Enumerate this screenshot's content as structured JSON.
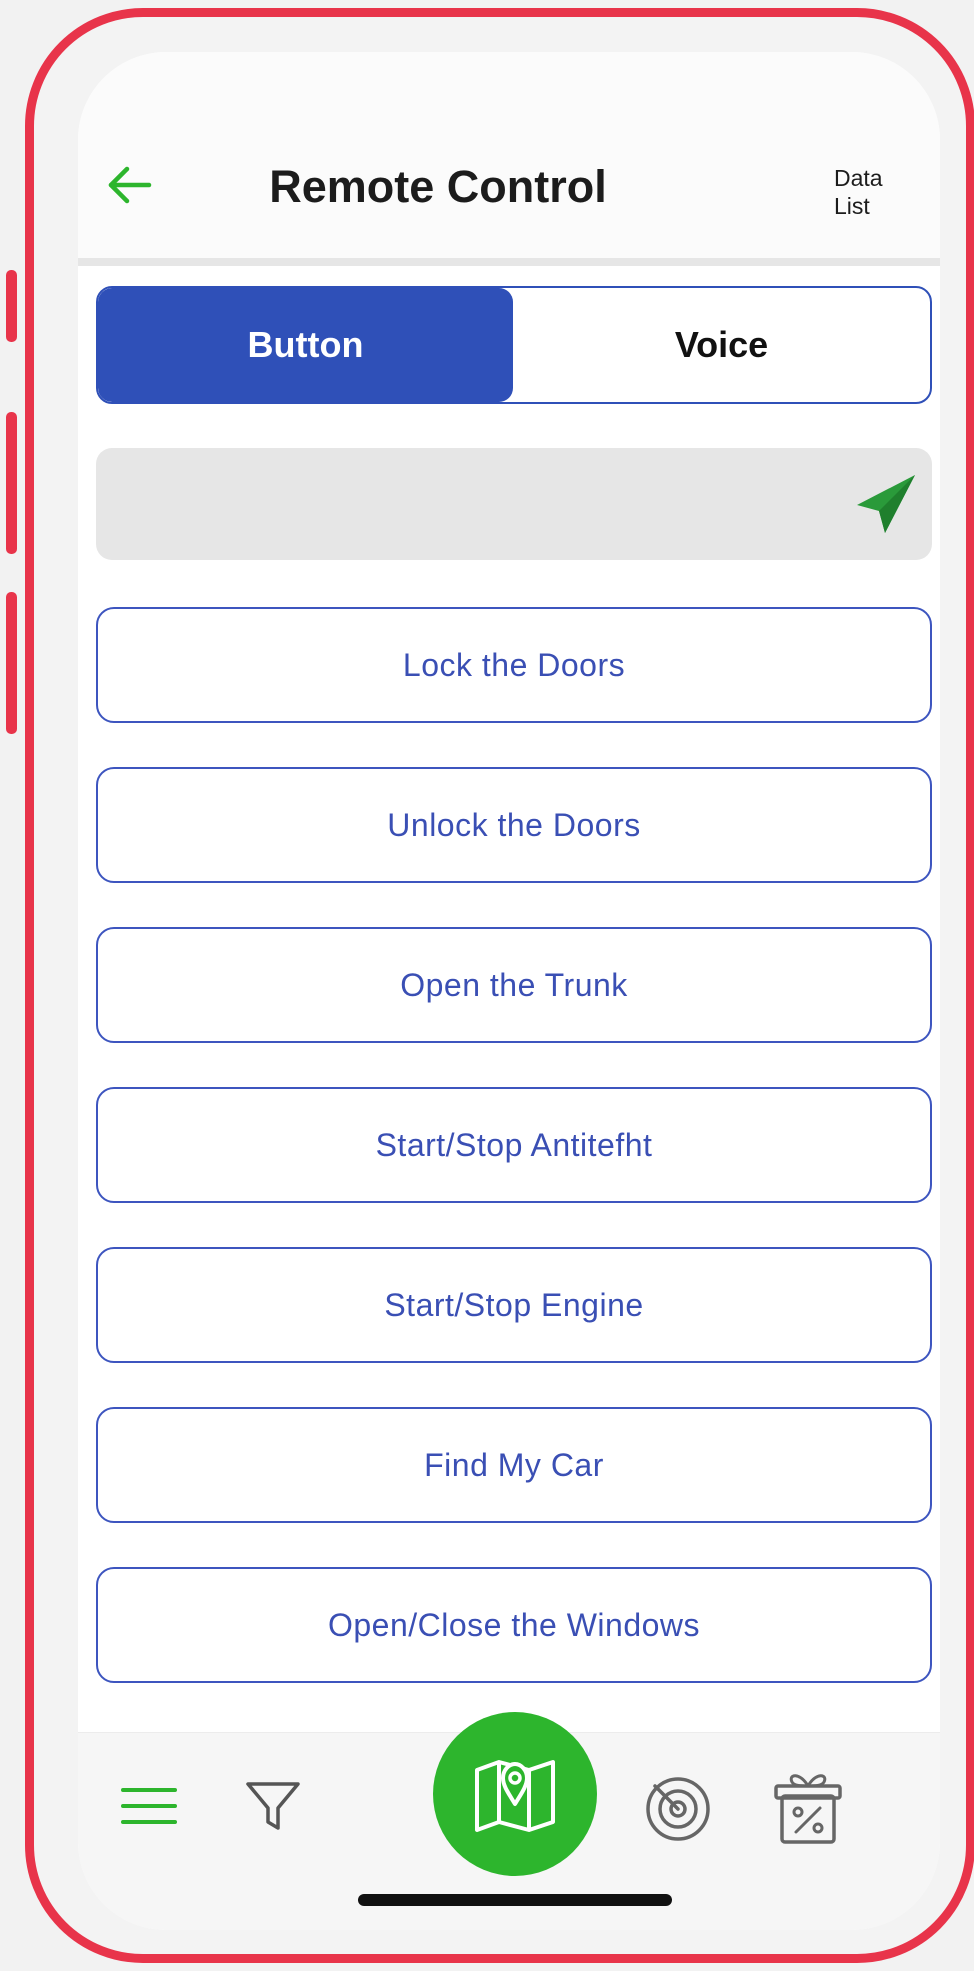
{
  "header": {
    "title": "Remote Control",
    "data_list_line1": "Data",
    "data_list_line2": "List"
  },
  "mode_toggle": {
    "options": [
      "Button",
      "Voice"
    ],
    "selected": "Button"
  },
  "command_input": {
    "value": "",
    "placeholder": ""
  },
  "actions": [
    {
      "label": "Lock the Doors"
    },
    {
      "label": "Unlock the Doors"
    },
    {
      "label": "Open the Trunk"
    },
    {
      "label": "Start/Stop Antitefht"
    },
    {
      "label": "Start/Stop Engine"
    },
    {
      "label": "Find My Car"
    },
    {
      "label": "Open/Close the Windows"
    }
  ],
  "tab_bar": {
    "items": [
      {
        "icon": "menu-icon"
      },
      {
        "icon": "filter-icon"
      },
      {
        "icon": "map-pin-icon",
        "active": true
      },
      {
        "icon": "radar-icon"
      },
      {
        "icon": "gift-discount-icon"
      }
    ]
  },
  "colors": {
    "frame": "#e8344a",
    "primary_blue": "#2f50b8",
    "accent_green": "#2db52d",
    "input_bg": "#e6e6e6"
  }
}
